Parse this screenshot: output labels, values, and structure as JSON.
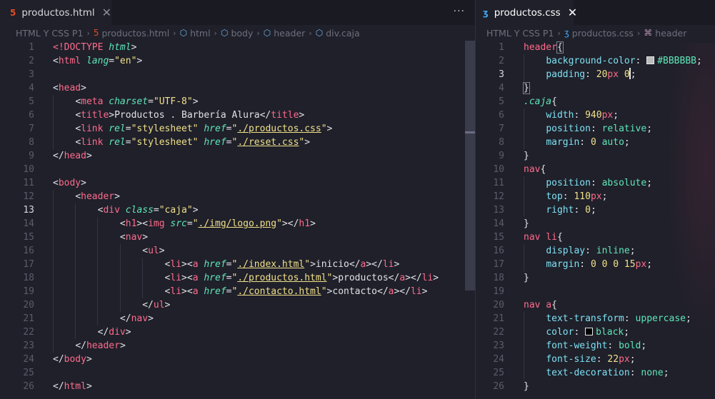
{
  "left": {
    "tab": {
      "icon": "html5-file-icon",
      "label": "productos.html",
      "close": "✕"
    },
    "more": "···",
    "breadcrumb": [
      "HTML Y CSS P1",
      "productos.html",
      "html",
      "body",
      "header",
      "div.caja"
    ],
    "current_line": 13
  },
  "right": {
    "tab": {
      "icon": "css3-file-icon",
      "label": "productos.css",
      "close": "✕"
    },
    "breadcrumb": [
      "HTML Y CSS P1",
      "productos.css",
      "header"
    ],
    "current_line": 3
  },
  "html_lines": [
    [
      [
        "t-doctype",
        "<!DOCTYPE "
      ],
      [
        "t-attr",
        "html"
      ],
      [
        "t-punc",
        ">"
      ]
    ],
    [
      [
        "t-punc",
        "<"
      ],
      [
        "t-tag",
        "html "
      ],
      [
        "t-attr",
        "lang"
      ],
      [
        "t-punc",
        "="
      ],
      [
        "t-str",
        "\"en\""
      ],
      [
        "t-punc",
        ">"
      ]
    ],
    [],
    [
      [
        "t-punc",
        "<"
      ],
      [
        "t-tag",
        "head"
      ],
      [
        "t-punc",
        ">"
      ]
    ],
    [
      [
        "t-text",
        "    "
      ],
      [
        "t-punc",
        "<"
      ],
      [
        "t-tag",
        "meta "
      ],
      [
        "t-attr",
        "charset"
      ],
      [
        "t-punc",
        "="
      ],
      [
        "t-str",
        "\"UTF-8\""
      ],
      [
        "t-punc",
        ">"
      ]
    ],
    [
      [
        "t-text",
        "    "
      ],
      [
        "t-punc",
        "<"
      ],
      [
        "t-tag",
        "title"
      ],
      [
        "t-punc",
        ">"
      ],
      [
        "t-text",
        "Productos . Barbería Alura"
      ],
      [
        "t-punc",
        "</"
      ],
      [
        "t-tag",
        "title"
      ],
      [
        "t-punc",
        ">"
      ]
    ],
    [
      [
        "t-text",
        "    "
      ],
      [
        "t-punc",
        "<"
      ],
      [
        "t-tag",
        "link "
      ],
      [
        "t-attr",
        "rel"
      ],
      [
        "t-punc",
        "="
      ],
      [
        "t-str",
        "\"stylesheet\" "
      ],
      [
        "t-attr",
        "href"
      ],
      [
        "t-punc",
        "="
      ],
      [
        "t-str",
        "\""
      ],
      [
        "t-link",
        "./productos.css"
      ],
      [
        "t-str",
        "\""
      ],
      [
        "t-punc",
        ">"
      ]
    ],
    [
      [
        "t-text",
        "    "
      ],
      [
        "t-punc",
        "<"
      ],
      [
        "t-tag",
        "link "
      ],
      [
        "t-attr",
        "rel"
      ],
      [
        "t-punc",
        "="
      ],
      [
        "t-str",
        "\"stylesheet\" "
      ],
      [
        "t-attr",
        "href"
      ],
      [
        "t-punc",
        "="
      ],
      [
        "t-str",
        "\""
      ],
      [
        "t-link",
        "./reset.css"
      ],
      [
        "t-str",
        "\""
      ],
      [
        "t-punc",
        ">"
      ]
    ],
    [
      [
        "t-punc",
        "</"
      ],
      [
        "t-tag",
        "head"
      ],
      [
        "t-punc",
        ">"
      ]
    ],
    [],
    [
      [
        "t-punc",
        "<"
      ],
      [
        "t-tag",
        "body"
      ],
      [
        "t-punc",
        ">"
      ]
    ],
    [
      [
        "t-text",
        "    "
      ],
      [
        "t-punc",
        "<"
      ],
      [
        "t-tag",
        "header"
      ],
      [
        "t-punc",
        ">"
      ]
    ],
    [
      [
        "t-text",
        "        "
      ],
      [
        "t-punc",
        "<"
      ],
      [
        "t-tag",
        "div "
      ],
      [
        "t-attr",
        "class"
      ],
      [
        "t-punc",
        "="
      ],
      [
        "t-str",
        "\"caja\""
      ],
      [
        "t-punc",
        ">"
      ]
    ],
    [
      [
        "t-text",
        "            "
      ],
      [
        "t-punc",
        "<"
      ],
      [
        "t-tag",
        "h1"
      ],
      [
        "t-punc",
        "><"
      ],
      [
        "t-tag",
        "img "
      ],
      [
        "t-attr",
        "src"
      ],
      [
        "t-punc",
        "="
      ],
      [
        "t-str",
        "\""
      ],
      [
        "t-link",
        "./img/logo.png"
      ],
      [
        "t-str",
        "\""
      ],
      [
        "t-punc",
        "></"
      ],
      [
        "t-tag",
        "h1"
      ],
      [
        "t-punc",
        ">"
      ]
    ],
    [
      [
        "t-text",
        "            "
      ],
      [
        "t-punc",
        "<"
      ],
      [
        "t-tag",
        "nav"
      ],
      [
        "t-punc",
        ">"
      ]
    ],
    [
      [
        "t-text",
        "                "
      ],
      [
        "t-punc",
        "<"
      ],
      [
        "t-tag",
        "ul"
      ],
      [
        "t-punc",
        ">"
      ]
    ],
    [
      [
        "t-text",
        "                    "
      ],
      [
        "t-punc",
        "<"
      ],
      [
        "t-tag",
        "li"
      ],
      [
        "t-punc",
        "><"
      ],
      [
        "t-tag",
        "a "
      ],
      [
        "t-attr",
        "href"
      ],
      [
        "t-punc",
        "="
      ],
      [
        "t-str",
        "\""
      ],
      [
        "t-link",
        "./index.html"
      ],
      [
        "t-str",
        "\""
      ],
      [
        "t-punc",
        ">"
      ],
      [
        "t-text",
        "inicio"
      ],
      [
        "t-punc",
        "</"
      ],
      [
        "t-tag",
        "a"
      ],
      [
        "t-punc",
        "></"
      ],
      [
        "t-tag",
        "li"
      ],
      [
        "t-punc",
        ">"
      ]
    ],
    [
      [
        "t-text",
        "                    "
      ],
      [
        "t-punc",
        "<"
      ],
      [
        "t-tag",
        "li"
      ],
      [
        "t-punc",
        "><"
      ],
      [
        "t-tag",
        "a "
      ],
      [
        "t-attr",
        "href"
      ],
      [
        "t-punc",
        "="
      ],
      [
        "t-str",
        "\""
      ],
      [
        "t-link",
        "./productos.html"
      ],
      [
        "t-str",
        "\""
      ],
      [
        "t-punc",
        ">"
      ],
      [
        "t-text",
        "productos"
      ],
      [
        "t-punc",
        "</"
      ],
      [
        "t-tag",
        "a"
      ],
      [
        "t-punc",
        "></"
      ],
      [
        "t-tag",
        "li"
      ],
      [
        "t-punc",
        ">"
      ]
    ],
    [
      [
        "t-text",
        "                    "
      ],
      [
        "t-punc",
        "<"
      ],
      [
        "t-tag",
        "li"
      ],
      [
        "t-punc",
        "><"
      ],
      [
        "t-tag",
        "a "
      ],
      [
        "t-attr",
        "href"
      ],
      [
        "t-punc",
        "="
      ],
      [
        "t-str",
        "\""
      ],
      [
        "t-link",
        "./contacto.html"
      ],
      [
        "t-str",
        "\""
      ],
      [
        "t-punc",
        ">"
      ],
      [
        "t-text",
        "contacto"
      ],
      [
        "t-punc",
        "</"
      ],
      [
        "t-tag",
        "a"
      ],
      [
        "t-punc",
        "></"
      ],
      [
        "t-tag",
        "li"
      ],
      [
        "t-punc",
        ">"
      ]
    ],
    [
      [
        "t-text",
        "                "
      ],
      [
        "t-punc",
        "</"
      ],
      [
        "t-tag",
        "ul"
      ],
      [
        "t-punc",
        ">"
      ]
    ],
    [
      [
        "t-text",
        "            "
      ],
      [
        "t-punc",
        "</"
      ],
      [
        "t-tag",
        "nav"
      ],
      [
        "t-punc",
        ">"
      ]
    ],
    [
      [
        "t-text",
        "        "
      ],
      [
        "t-punc",
        "</"
      ],
      [
        "t-tag",
        "div"
      ],
      [
        "t-punc",
        ">"
      ]
    ],
    [
      [
        "t-text",
        "    "
      ],
      [
        "t-punc",
        "</"
      ],
      [
        "t-tag",
        "header"
      ],
      [
        "t-punc",
        ">"
      ]
    ],
    [
      [
        "t-punc",
        "</"
      ],
      [
        "t-tag",
        "body"
      ],
      [
        "t-punc",
        ">"
      ]
    ],
    [],
    [
      [
        "t-punc",
        "</"
      ],
      [
        "t-tag",
        "html"
      ],
      [
        "t-punc",
        ">"
      ]
    ]
  ],
  "css_lines": [
    [
      [
        "t-sel",
        "header"
      ],
      [
        "t-punc hl",
        "{"
      ]
    ],
    [
      [
        "t-text",
        "    "
      ],
      [
        "t-prop",
        "background-color"
      ],
      [
        "t-punc",
        ": "
      ],
      [
        "swatch",
        "#BBBBBB"
      ],
      [
        "t-val",
        "#BBBBBB"
      ],
      [
        "t-punc",
        ";"
      ]
    ],
    [
      [
        "t-text",
        "    "
      ],
      [
        "t-prop",
        "padding"
      ],
      [
        "t-punc",
        ": "
      ],
      [
        "t-num",
        "20"
      ],
      [
        "t-unit",
        "px "
      ],
      [
        "t-num",
        "0"
      ],
      [
        "cursor",
        ""
      ],
      [
        "t-punc",
        ";"
      ]
    ],
    [
      [
        "t-punc hl",
        "}"
      ]
    ],
    [
      [
        "t-cls",
        ".caja"
      ],
      [
        "t-punc",
        "{"
      ]
    ],
    [
      [
        "t-text",
        "    "
      ],
      [
        "t-prop",
        "width"
      ],
      [
        "t-punc",
        ": "
      ],
      [
        "t-num",
        "940"
      ],
      [
        "t-unit",
        "px"
      ],
      [
        "t-punc",
        ";"
      ]
    ],
    [
      [
        "t-text",
        "    "
      ],
      [
        "t-prop",
        "position"
      ],
      [
        "t-punc",
        ": "
      ],
      [
        "t-val",
        "relative"
      ],
      [
        "t-punc",
        ";"
      ]
    ],
    [
      [
        "t-text",
        "    "
      ],
      [
        "t-prop",
        "margin"
      ],
      [
        "t-punc",
        ": "
      ],
      [
        "t-num",
        "0 "
      ],
      [
        "t-val",
        "auto"
      ],
      [
        "t-punc",
        ";"
      ]
    ],
    [
      [
        "t-punc",
        "}"
      ]
    ],
    [
      [
        "t-sel",
        "nav"
      ],
      [
        "t-punc",
        "{"
      ]
    ],
    [
      [
        "t-text",
        "    "
      ],
      [
        "t-prop",
        "position"
      ],
      [
        "t-punc",
        ": "
      ],
      [
        "t-val",
        "absolute"
      ],
      [
        "t-punc",
        ";"
      ]
    ],
    [
      [
        "t-text",
        "    "
      ],
      [
        "t-prop",
        "top"
      ],
      [
        "t-punc",
        ": "
      ],
      [
        "t-num",
        "110"
      ],
      [
        "t-unit",
        "px"
      ],
      [
        "t-punc",
        ";"
      ]
    ],
    [
      [
        "t-text",
        "    "
      ],
      [
        "t-prop",
        "right"
      ],
      [
        "t-punc",
        ": "
      ],
      [
        "t-num",
        "0"
      ],
      [
        "t-punc",
        ";"
      ]
    ],
    [
      [
        "t-punc",
        "}"
      ]
    ],
    [
      [
        "t-sel",
        "nav li"
      ],
      [
        "t-punc",
        "{"
      ]
    ],
    [
      [
        "t-text",
        "    "
      ],
      [
        "t-prop",
        "display"
      ],
      [
        "t-punc",
        ": "
      ],
      [
        "t-val",
        "inline"
      ],
      [
        "t-punc",
        ";"
      ]
    ],
    [
      [
        "t-text",
        "    "
      ],
      [
        "t-prop",
        "margin"
      ],
      [
        "t-punc",
        ": "
      ],
      [
        "t-num",
        "0 0 0 15"
      ],
      [
        "t-unit",
        "px"
      ],
      [
        "t-punc",
        ";"
      ]
    ],
    [
      [
        "t-punc",
        "}"
      ]
    ],
    [],
    [
      [
        "t-sel",
        "nav a"
      ],
      [
        "t-punc",
        "{"
      ]
    ],
    [
      [
        "t-text",
        "    "
      ],
      [
        "t-prop",
        "text-transform"
      ],
      [
        "t-punc",
        ": "
      ],
      [
        "t-val",
        "uppercase"
      ],
      [
        "t-punc",
        ";"
      ]
    ],
    [
      [
        "t-text",
        "    "
      ],
      [
        "t-prop",
        "color"
      ],
      [
        "t-punc",
        ": "
      ],
      [
        "swatch",
        "#000000"
      ],
      [
        "t-val",
        "black"
      ],
      [
        "t-punc",
        ";"
      ]
    ],
    [
      [
        "t-text",
        "    "
      ],
      [
        "t-prop",
        "font-weight"
      ],
      [
        "t-punc",
        ": "
      ],
      [
        "t-val",
        "bold"
      ],
      [
        "t-punc",
        ";"
      ]
    ],
    [
      [
        "t-text",
        "    "
      ],
      [
        "t-prop",
        "font-size"
      ],
      [
        "t-punc",
        ": "
      ],
      [
        "t-num",
        "22"
      ],
      [
        "t-unit",
        "px"
      ],
      [
        "t-punc",
        ";"
      ]
    ],
    [
      [
        "t-text",
        "    "
      ],
      [
        "t-prop",
        "text-decoration"
      ],
      [
        "t-punc",
        ": "
      ],
      [
        "t-val",
        "none"
      ],
      [
        "t-punc",
        ";"
      ]
    ],
    [
      [
        "t-punc",
        "}"
      ]
    ]
  ],
  "colors": {
    "background": "#1f202a",
    "tag": "#ff6b8b",
    "attr": "#5fe6b8",
    "string": "#f1e08a",
    "property": "#7ee0f2",
    "html_icon": "#e34c26",
    "css_icon": "#42a5f5"
  }
}
